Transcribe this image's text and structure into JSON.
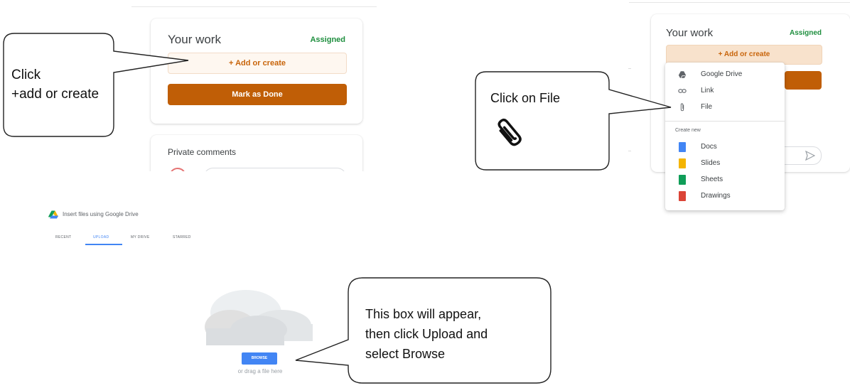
{
  "panel1": {
    "title": "Your work",
    "status": "Assigned",
    "add_label": "+ Add or create",
    "done_label": "Mark as Done",
    "comments_title": "Private comments"
  },
  "callout1": {
    "line1": "Click",
    "line2": "+add or create"
  },
  "panel2": {
    "title": "Your work",
    "status": "Assigned",
    "add_label": "+ Add or create",
    "menu": {
      "items": [
        {
          "label": "Google Drive",
          "icon": "google-drive-icon"
        },
        {
          "label": "Link",
          "icon": "link-icon"
        },
        {
          "label": "File",
          "icon": "attachment-icon"
        }
      ],
      "create_header": "Create new",
      "create_items": [
        {
          "label": "Docs",
          "icon": "docs-icon",
          "color": "#4285f4"
        },
        {
          "label": "Slides",
          "icon": "slides-icon",
          "color": "#f4b400"
        },
        {
          "label": "Sheets",
          "icon": "sheets-icon",
          "color": "#0f9d58"
        },
        {
          "label": "Drawings",
          "icon": "drawings-icon",
          "color": "#db4437"
        }
      ]
    }
  },
  "callout2": {
    "text": "Click on File",
    "icon": "paperclip-icon"
  },
  "picker": {
    "title": "Insert files using Google Drive",
    "tabs": [
      "RECENT",
      "UPLOAD",
      "MY DRIVE",
      "STARRED"
    ],
    "active_tab": "UPLOAD",
    "browse_label": "BROWSE",
    "drag_text": "or drag a file here"
  },
  "callout3": {
    "line1": "This box will appear,",
    "line2": "then click Upload and",
    "line3": "select Browse"
  },
  "colors": {
    "accent_orange": "#c05e06",
    "assigned_green": "#1e8e3e",
    "browse_blue": "#4285f4"
  }
}
